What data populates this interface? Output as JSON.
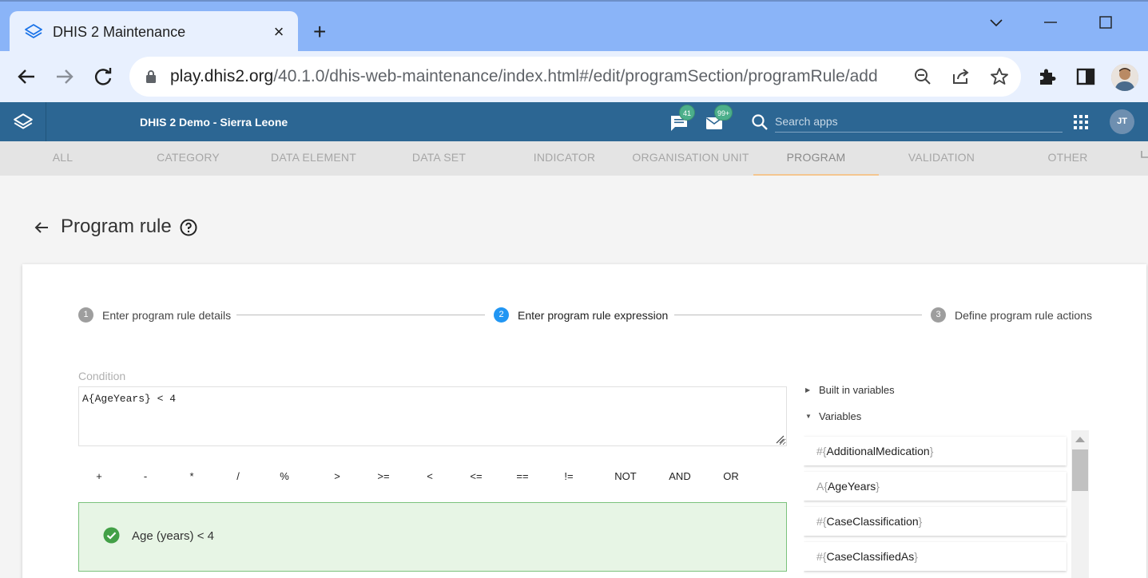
{
  "browser": {
    "tab_title": "DHIS 2 Maintenance",
    "tab_close": "×",
    "new_tab": "+",
    "url_host": "play.dhis2.org",
    "url_path": "/40.1.0/dhis-web-maintenance/index.html#/edit/programSection/programRule/add"
  },
  "header": {
    "title": "DHIS 2 Demo - Sierra Leone",
    "messages_count": "41",
    "mail_count": "99+",
    "search_placeholder": "Search apps",
    "user_initials": "JT"
  },
  "sections": [
    {
      "label": "ALL"
    },
    {
      "label": "CATEGORY"
    },
    {
      "label": "DATA ELEMENT"
    },
    {
      "label": "DATA SET"
    },
    {
      "label": "INDICATOR"
    },
    {
      "label": "ORGANISATION UNIT"
    },
    {
      "label": "PROGRAM",
      "active": true
    },
    {
      "label": "VALIDATION"
    },
    {
      "label": "OTHER"
    }
  ],
  "page": {
    "title": "Program rule"
  },
  "stepper": [
    {
      "num": "1",
      "label": "Enter program rule details"
    },
    {
      "num": "2",
      "label": "Enter program rule expression",
      "active": true
    },
    {
      "num": "3",
      "label": "Define program rule actions"
    }
  ],
  "condition": {
    "label": "Condition",
    "value": "A{AgeYears} < 4"
  },
  "operators": [
    "+",
    "-",
    "*",
    "/",
    "%",
    ">",
    ">=",
    "<",
    "<=",
    "==",
    "!=",
    "NOT",
    "AND",
    "OR"
  ],
  "validation": {
    "text": "Age (years) < 4",
    "status_color": "#43a047"
  },
  "variables_panel": {
    "builtin_label": "Built in variables",
    "variables_label": "Variables",
    "items": [
      {
        "prefix": "#",
        "name": "AdditionalMedication"
      },
      {
        "prefix": "A",
        "name": "AgeYears"
      },
      {
        "prefix": "#",
        "name": "CaseClassification"
      },
      {
        "prefix": "#",
        "name": "CaseClassifiedAs"
      }
    ]
  },
  "colors": {
    "header_blue": "#2c6693",
    "active_step": "#2196f3",
    "tab_underline": "#f4c690"
  }
}
